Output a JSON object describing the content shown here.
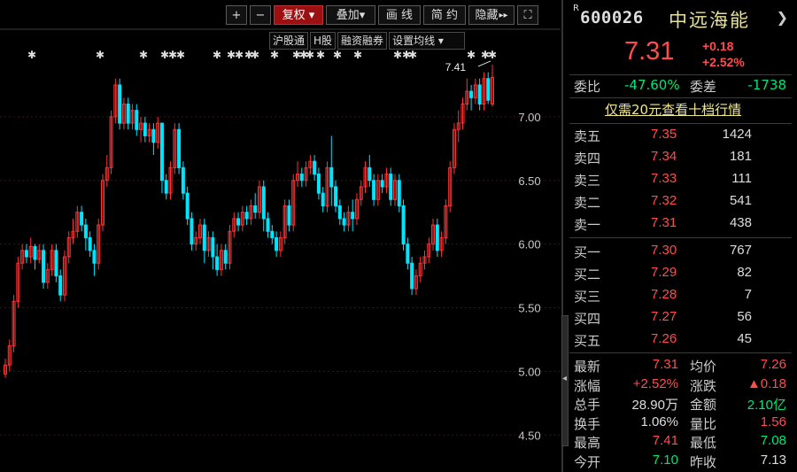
{
  "toolbar": {
    "zoom_in": "+",
    "zoom_out": "−",
    "adjust": "复权 ▾",
    "overlay": "叠加▾",
    "draw": "画 线",
    "simple": "简 约",
    "hide": "隐藏",
    "hide_arrow": "▸▸",
    "fullscreen": "⛶"
  },
  "subbar": {
    "hsgt": "沪股通",
    "hshare": "H股",
    "margin": "融资融券",
    "ma_settings": "设置均线 ▾"
  },
  "colors": {
    "up": "#ff3333",
    "down": "#00e5ff",
    "grid": "#4a0d0d",
    "axis_text": "#c8c8c8",
    "bg": "#000000"
  },
  "chart_data": {
    "type": "candlestick",
    "ylim": [
      4.3,
      7.5
    ],
    "yticks": [
      "7.00",
      "6.50",
      "6.00",
      "5.50",
      "5.00",
      "4.50"
    ],
    "high_label": "7.41",
    "candles": [
      [
        4.98,
        5.05,
        4.95,
        5.1
      ],
      [
        5.05,
        5.2,
        5.0,
        5.25
      ],
      [
        5.2,
        5.55,
        5.15,
        5.6
      ],
      [
        5.55,
        5.85,
        5.5,
        5.9
      ],
      [
        5.85,
        5.95,
        5.8,
        6.0
      ],
      [
        5.95,
        5.9,
        5.85,
        6.0
      ],
      [
        5.9,
        5.98,
        5.85,
        6.05
      ],
      [
        5.98,
        5.88,
        5.8,
        6.0
      ],
      [
        5.88,
        5.95,
        5.85,
        6.0
      ],
      [
        5.95,
        5.7,
        5.65,
        6.0
      ],
      [
        5.7,
        5.8,
        5.65,
        5.85
      ],
      [
        5.8,
        5.95,
        5.75,
        6.0
      ],
      [
        5.95,
        5.75,
        5.7,
        6.0
      ],
      [
        5.75,
        5.6,
        5.55,
        5.8
      ],
      [
        5.6,
        5.9,
        5.55,
        5.95
      ],
      [
        5.9,
        6.05,
        5.85,
        6.1
      ],
      [
        6.05,
        6.1,
        6.0,
        6.2
      ],
      [
        6.1,
        6.25,
        6.05,
        6.3
      ],
      [
        6.25,
        6.15,
        6.1,
        6.3
      ],
      [
        6.15,
        6.05,
        5.95,
        6.2
      ],
      [
        6.05,
        5.95,
        5.9,
        6.1
      ],
      [
        5.95,
        5.85,
        5.75,
        6.0
      ],
      [
        5.85,
        6.15,
        5.8,
        6.2
      ],
      [
        6.15,
        6.5,
        6.1,
        6.55
      ],
      [
        6.5,
        6.6,
        6.45,
        6.7
      ],
      [
        6.6,
        7.0,
        6.55,
        7.05
      ],
      [
        7.0,
        7.25,
        6.95,
        7.3
      ],
      [
        7.25,
        6.95,
        6.9,
        7.3
      ],
      [
        6.95,
        7.1,
        6.9,
        7.15
      ],
      [
        7.1,
        6.95,
        6.9,
        7.15
      ],
      [
        6.95,
        7.05,
        6.9,
        7.1
      ],
      [
        7.05,
        6.9,
        6.85,
        7.1
      ],
      [
        6.9,
        6.95,
        6.8,
        7.0
      ],
      [
        6.95,
        6.85,
        6.8,
        7.0
      ],
      [
        6.85,
        6.9,
        6.8,
        6.95
      ],
      [
        6.9,
        6.8,
        6.7,
        6.95
      ],
      [
        6.8,
        6.95,
        6.75,
        7.0
      ],
      [
        6.95,
        6.5,
        6.4,
        6.95
      ],
      [
        6.5,
        6.4,
        6.35,
        6.55
      ],
      [
        6.4,
        6.6,
        6.35,
        6.65
      ],
      [
        6.6,
        6.9,
        6.55,
        6.95
      ],
      [
        6.9,
        6.6,
        6.55,
        6.95
      ],
      [
        6.6,
        6.4,
        6.35,
        6.65
      ],
      [
        6.4,
        6.2,
        6.15,
        6.45
      ],
      [
        6.2,
        6.0,
        5.95,
        6.25
      ],
      [
        6.0,
        6.05,
        5.95,
        6.1
      ],
      [
        6.05,
        6.15,
        6.0,
        6.2
      ],
      [
        6.15,
        5.95,
        5.85,
        6.2
      ],
      [
        5.95,
        6.05,
        5.9,
        6.1
      ],
      [
        6.05,
        5.9,
        5.8,
        6.1
      ],
      [
        5.9,
        5.8,
        5.75,
        6.0
      ],
      [
        5.8,
        5.95,
        5.75,
        6.0
      ],
      [
        5.95,
        5.85,
        5.8,
        6.0
      ],
      [
        5.85,
        6.1,
        5.8,
        6.15
      ],
      [
        6.1,
        6.2,
        6.05,
        6.25
      ],
      [
        6.2,
        6.15,
        6.1,
        6.25
      ],
      [
        6.15,
        6.25,
        6.1,
        6.3
      ],
      [
        6.25,
        6.2,
        6.15,
        6.3
      ],
      [
        6.2,
        6.3,
        6.15,
        6.35
      ],
      [
        6.3,
        6.25,
        6.2,
        6.4
      ],
      [
        6.25,
        6.45,
        6.2,
        6.5
      ],
      [
        6.45,
        6.2,
        6.1,
        6.5
      ],
      [
        6.2,
        6.1,
        6.05,
        6.25
      ],
      [
        6.1,
        6.05,
        6.0,
        6.15
      ],
      [
        6.05,
        5.95,
        5.9,
        6.1
      ],
      [
        5.95,
        6.05,
        5.9,
        6.1
      ],
      [
        6.05,
        6.3,
        6.0,
        6.35
      ],
      [
        6.3,
        6.15,
        6.1,
        6.35
      ],
      [
        6.15,
        6.5,
        6.1,
        6.55
      ],
      [
        6.5,
        6.55,
        6.45,
        6.65
      ],
      [
        6.55,
        6.5,
        6.45,
        6.6
      ],
      [
        6.5,
        6.6,
        6.45,
        6.65
      ],
      [
        6.6,
        6.65,
        6.55,
        6.7
      ],
      [
        6.65,
        6.55,
        6.5,
        6.7
      ],
      [
        6.55,
        6.4,
        6.35,
        6.6
      ],
      [
        6.4,
        6.3,
        6.25,
        6.45
      ],
      [
        6.3,
        6.6,
        6.25,
        6.65
      ],
      [
        6.6,
        6.45,
        6.3,
        6.85
      ],
      [
        6.45,
        6.3,
        6.25,
        6.5
      ],
      [
        6.3,
        6.2,
        6.15,
        6.35
      ],
      [
        6.2,
        6.15,
        6.1,
        6.25
      ],
      [
        6.15,
        6.25,
        6.1,
        6.3
      ],
      [
        6.25,
        6.2,
        6.1,
        6.35
      ],
      [
        6.2,
        6.35,
        6.15,
        6.4
      ],
      [
        6.35,
        6.45,
        6.3,
        6.5
      ],
      [
        6.45,
        6.6,
        6.4,
        6.65
      ],
      [
        6.6,
        6.5,
        6.45,
        6.7
      ],
      [
        6.5,
        6.35,
        6.3,
        6.55
      ],
      [
        6.35,
        6.5,
        6.3,
        6.55
      ],
      [
        6.5,
        6.45,
        6.4,
        6.55
      ],
      [
        6.45,
        6.55,
        6.4,
        6.6
      ],
      [
        6.55,
        6.35,
        6.3,
        6.6
      ],
      [
        6.35,
        6.5,
        6.3,
        6.55
      ],
      [
        6.5,
        6.3,
        6.25,
        6.55
      ],
      [
        6.3,
        6.0,
        5.95,
        6.35
      ],
      [
        6.0,
        5.85,
        5.8,
        6.05
      ],
      [
        5.85,
        5.65,
        5.6,
        5.9
      ],
      [
        5.65,
        5.75,
        5.6,
        5.8
      ],
      [
        5.75,
        5.85,
        5.7,
        5.9
      ],
      [
        5.85,
        5.9,
        5.8,
        5.95
      ],
      [
        5.9,
        6.0,
        5.85,
        6.05
      ],
      [
        6.0,
        6.15,
        5.95,
        6.2
      ],
      [
        6.15,
        5.95,
        5.9,
        6.2
      ],
      [
        5.95,
        6.05,
        5.9,
        6.1
      ],
      [
        6.05,
        6.3,
        6.0,
        6.35
      ],
      [
        6.3,
        6.6,
        6.25,
        6.65
      ],
      [
        6.6,
        6.9,
        6.55,
        6.95
      ],
      [
        6.9,
        6.95,
        6.8,
        7.05
      ],
      [
        6.95,
        7.1,
        6.9,
        7.15
      ],
      [
        7.1,
        7.2,
        7.05,
        7.3
      ],
      [
        7.2,
        7.15,
        7.05,
        7.25
      ],
      [
        7.15,
        7.25,
        7.1,
        7.3
      ],
      [
        7.25,
        7.1,
        7.05,
        7.3
      ],
      [
        7.1,
        7.3,
        7.05,
        7.35
      ],
      [
        7.3,
        7.13,
        7.1,
        7.35
      ],
      [
        7.1,
        7.31,
        7.08,
        7.41
      ]
    ]
  },
  "stock": {
    "r_mark": "R",
    "code": "600026",
    "name": "中远海能",
    "price": "7.31",
    "change": "+0.18",
    "change_pct": "+2.52%"
  },
  "weibi": {
    "label1": "委比",
    "value1": "-47.60%",
    "label2": "委差",
    "value2": "-1738"
  },
  "level2_link": "仅需20元查看十档行情",
  "asks": [
    {
      "label": "卖五",
      "price": "7.35",
      "vol": "1424"
    },
    {
      "label": "卖四",
      "price": "7.34",
      "vol": "181"
    },
    {
      "label": "卖三",
      "price": "7.33",
      "vol": "111"
    },
    {
      "label": "卖二",
      "price": "7.32",
      "vol": "541"
    },
    {
      "label": "卖一",
      "price": "7.31",
      "vol": "438"
    }
  ],
  "bids": [
    {
      "label": "买一",
      "price": "7.30",
      "vol": "767"
    },
    {
      "label": "买二",
      "price": "7.29",
      "vol": "82"
    },
    {
      "label": "买三",
      "price": "7.28",
      "vol": "7"
    },
    {
      "label": "买四",
      "price": "7.27",
      "vol": "56"
    },
    {
      "label": "买五",
      "price": "7.26",
      "vol": "45"
    }
  ],
  "stats": [
    {
      "l1": "最新",
      "v1": "7.31",
      "l2": "均价",
      "v2": "7.26"
    },
    {
      "l1": "涨幅",
      "v1": "+2.52%",
      "l2": "涨跌",
      "v2": "▲0.18"
    },
    {
      "l1": "总手",
      "v1": "28.90万",
      "l2": "金额",
      "v2": "2.10亿"
    },
    {
      "l1": "换手",
      "v1": "1.06%",
      "l2": "量比",
      "v2": "1.56"
    },
    {
      "l1": "最高",
      "v1": "7.41",
      "l2": "最低",
      "v2": "7.08"
    },
    {
      "l1": "今开",
      "v1": "7.10",
      "l2": "昨收",
      "v2": "7.13"
    }
  ]
}
